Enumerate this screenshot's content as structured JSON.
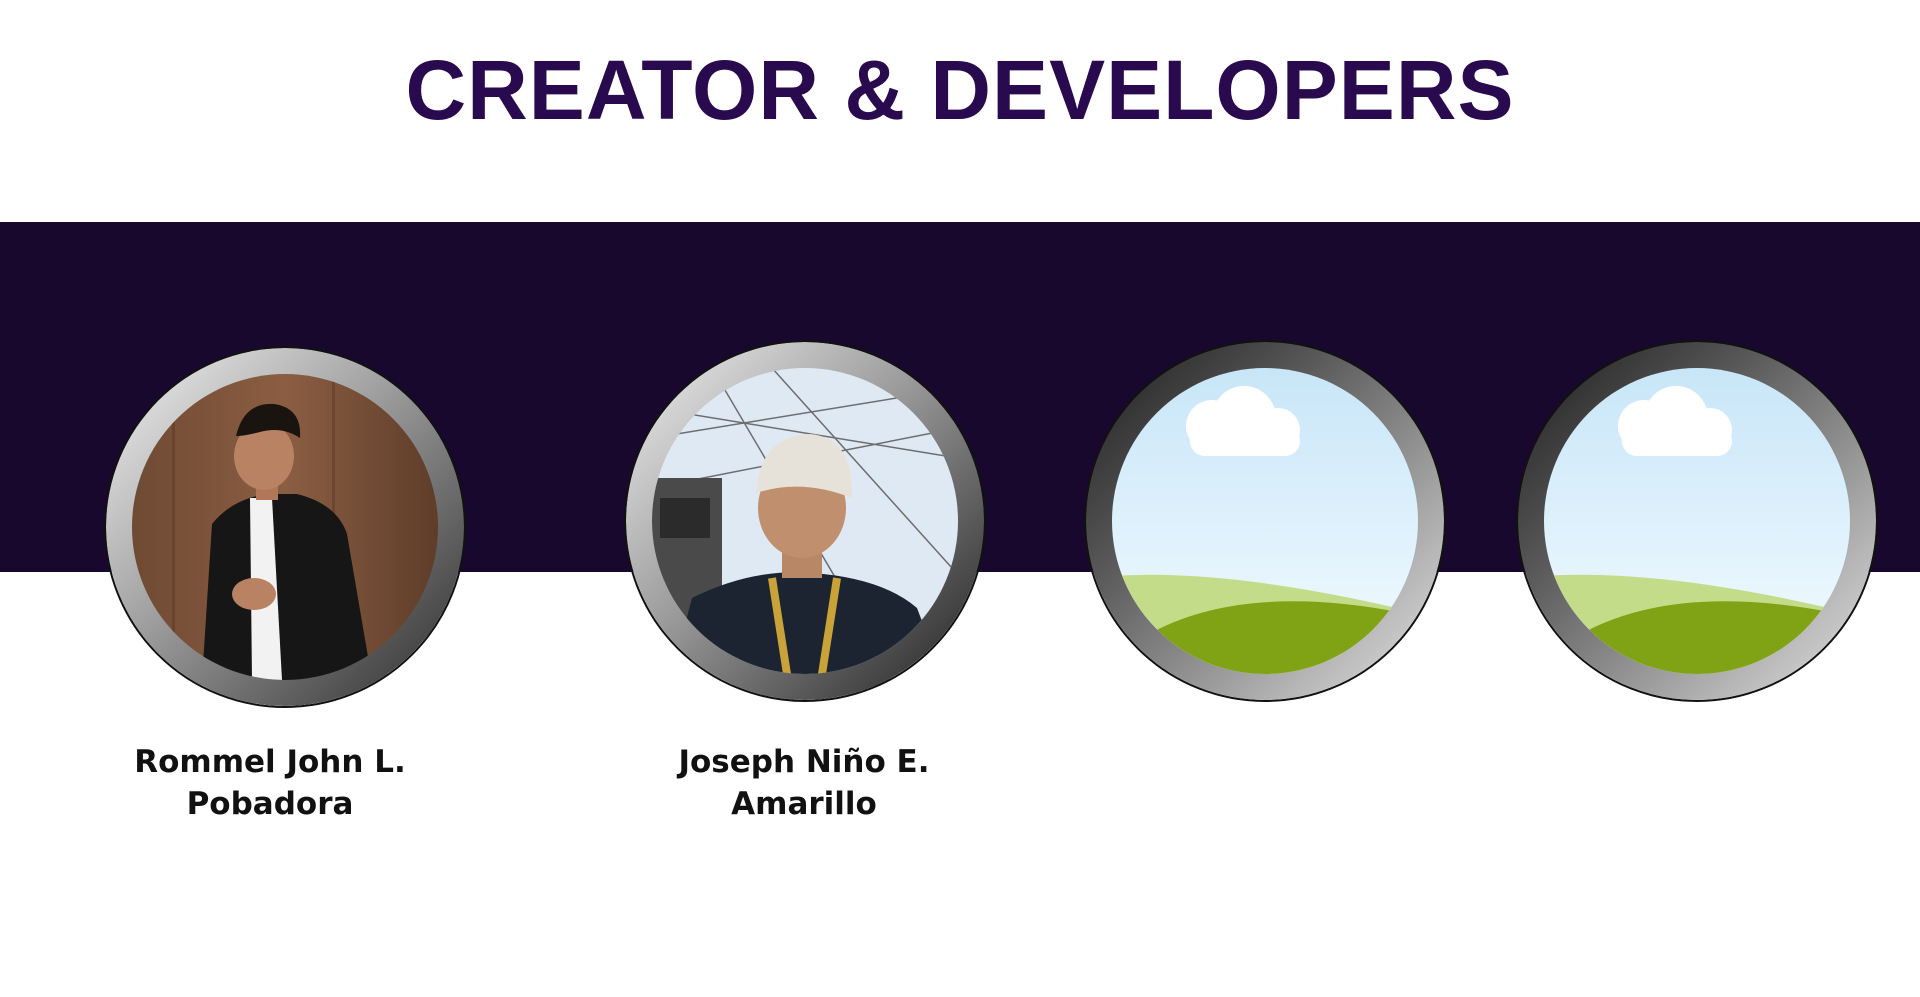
{
  "page": {
    "title": "CREATOR & DEVELOPERS",
    "colors": {
      "title": "#2a0a4f",
      "band": "#18082e",
      "name_text": "#111111",
      "background": "#ffffff"
    }
  },
  "members": [
    {
      "name_line1": "Rommel John L.",
      "name_line2": "Pobadora",
      "photo": "portrait-photo"
    },
    {
      "name_line1": "Joseph Niño E.",
      "name_line2": "Amarillo",
      "photo": "portrait-photo"
    },
    {
      "name_line1": "",
      "name_line2": "",
      "photo": "placeholder-landscape-icon"
    },
    {
      "name_line1": "",
      "name_line2": "",
      "photo": "placeholder-landscape-icon"
    }
  ]
}
